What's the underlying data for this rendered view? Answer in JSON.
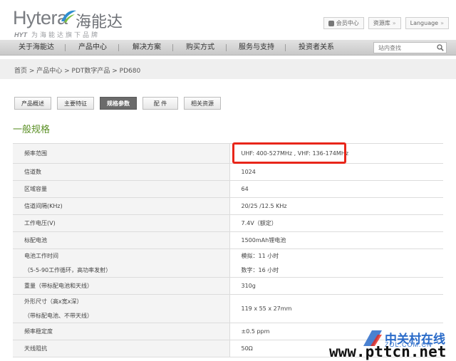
{
  "header": {
    "logo_text": "Hytera",
    "logo_cn": "海能达",
    "logo_sub_brand": "HYT",
    "logo_slogan": "为海能达旗下品牌",
    "top_links": [
      {
        "label": "会员中心",
        "icon": "user-icon"
      },
      {
        "label": "资源库",
        "icon": "chevron-right-icon"
      },
      {
        "label": "Language",
        "icon": "chevron-right-icon"
      }
    ]
  },
  "nav": {
    "items": [
      "关于海能达",
      "产品中心",
      "解决方案",
      "购买方式",
      "服务与支持",
      "投资者关系"
    ],
    "search_placeholder": "站内查找"
  },
  "breadcrumb": "首页 > 产品中心 > PDT数字产品 > PD680",
  "tabs": [
    {
      "label": "产品概述",
      "active": false
    },
    {
      "label": "主要特征",
      "active": false
    },
    {
      "label": "规格参数",
      "active": true
    },
    {
      "label": "配 件",
      "active": false
    },
    {
      "label": "相关资源",
      "active": false
    }
  ],
  "section_title": "一般规格",
  "specs": [
    {
      "label": "频率范围",
      "value": [
        "UHF: 400-527MHz , VHF: 136-174MHz"
      ]
    },
    {
      "label": "信道数",
      "value": [
        "1024"
      ]
    },
    {
      "label": "区域容量",
      "value": [
        "64"
      ]
    },
    {
      "label": "信道间隔(KHz)",
      "value": [
        "20/25 /12.5 KHz"
      ]
    },
    {
      "label": "工作电压(V)",
      "value": [
        "7.4V（额定）"
      ]
    },
    {
      "label": "标配电池",
      "value": [
        "1500mAh锂电池"
      ]
    },
    {
      "label": [
        "电池工作时间",
        "（5-5-90工作循环，高功率发射）"
      ],
      "value": [
        "模拟：11 小时",
        "数字：16 小时"
      ]
    },
    {
      "label": "重量（带标配电池和天线）",
      "value": [
        "310g"
      ]
    },
    {
      "label": [
        "外形尺寸（高x宽x深）",
        "（带标配电池、不带天线）"
      ],
      "value": [
        "119 x 55 x 27mm"
      ]
    },
    {
      "label": "频率稳定度",
      "value": [
        "±0.5 ppm"
      ]
    },
    {
      "label": "天线阻抗",
      "value": [
        "50Ω"
      ]
    }
  ],
  "watermark": {
    "cn": "中关村在线",
    "zol": "ZOL.COM.CN",
    "url": "www.pttcn.net"
  },
  "colors": {
    "accent_green": "#5a8f24",
    "highlight_red": "#e8261a",
    "watermark_blue": "#2a6bc9"
  }
}
